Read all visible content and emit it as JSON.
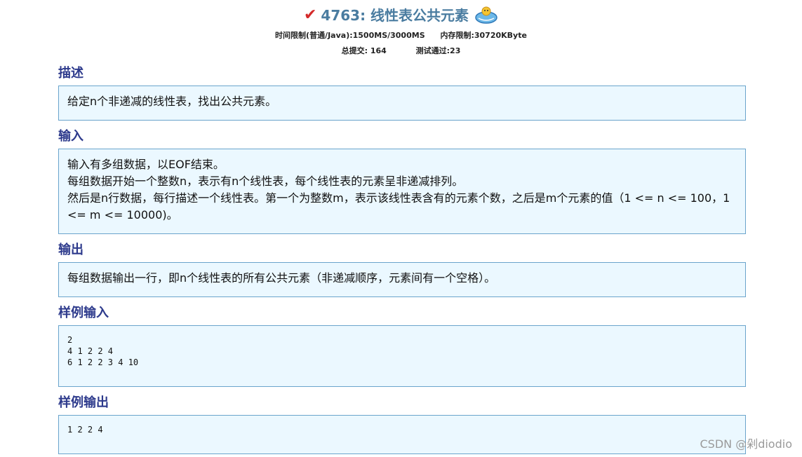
{
  "header": {
    "title": "4763: 线性表公共元素",
    "time_limit": "时间限制(普通/Java):1500MS/3000MS",
    "memory_limit": "内存限制:30720KByte",
    "total_submit": "总提交: 164",
    "passed": "测试通过:23",
    "check_color": "#d42a2a",
    "title_color": "#4a7ca0"
  },
  "sections": {
    "description": {
      "heading": "描述",
      "lines": [
        "给定n个非递减的线性表，找出公共元素。"
      ]
    },
    "input": {
      "heading": "输入",
      "lines": [
        "输入有多组数据，以EOF结束。",
        "每组数据开始一个整数n，表示有n个线性表，每个线性表的元素呈非递减排列。",
        "然后是n行数据，每行描述一个线性表。第一个为整数m，表示该线性表含有的元素个数，之后是m个元素的值（1 <= n <= 100，1 <= m <= 10000)。"
      ]
    },
    "output": {
      "heading": "输出",
      "lines": [
        "每组数据输出一行，即n个线性表的所有公共元素（非递减顺序，元素间有一个空格）。"
      ]
    },
    "sample_input": {
      "heading": "样例输入",
      "text": "2\n4 1 2 2 4\n6 1 2 2 3 4 10"
    },
    "sample_output": {
      "heading": "样例输出",
      "text": "1 2 2 4"
    }
  },
  "watermark": "CSDN @剁diodio",
  "colors": {
    "heading": "#2d3a8c",
    "box_bg": "#ebf8ff",
    "box_border": "#6aa4cc"
  }
}
